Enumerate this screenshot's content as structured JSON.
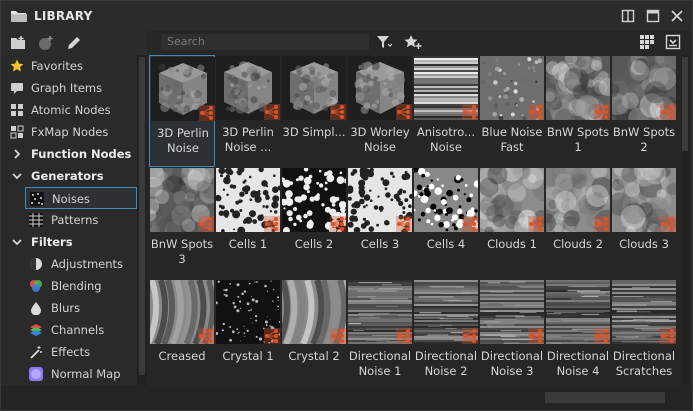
{
  "header": {
    "title": "LIBRARY"
  },
  "search": {
    "placeholder": "Search"
  },
  "sidebar": {
    "items": [
      {
        "label": "Favorites",
        "icon": "star-icon",
        "level": 0
      },
      {
        "label": "Graph Items",
        "icon": "graph-items-icon",
        "level": 0
      },
      {
        "label": "Atomic Nodes",
        "icon": "atomic-nodes-icon",
        "level": 0
      },
      {
        "label": "FxMap Nodes",
        "icon": "fxmap-icon",
        "level": 0
      },
      {
        "label": "Function Nodes",
        "icon": "chevron-right-icon",
        "level": 0,
        "bold": true
      },
      {
        "label": "Generators",
        "icon": "chevron-down-icon",
        "level": 0,
        "bold": true
      },
      {
        "label": "Noises",
        "icon": "noises-icon",
        "level": 1,
        "selected": true
      },
      {
        "label": "Patterns",
        "icon": "patterns-icon",
        "level": 1
      },
      {
        "label": "Filters",
        "icon": "chevron-down-icon",
        "level": 0,
        "bold": true
      },
      {
        "label": "Adjustments",
        "icon": "adjustments-icon",
        "level": 1
      },
      {
        "label": "Blending",
        "icon": "blending-icon",
        "level": 1
      },
      {
        "label": "Blurs",
        "icon": "blurs-icon",
        "level": 1
      },
      {
        "label": "Channels",
        "icon": "channels-icon",
        "level": 1
      },
      {
        "label": "Effects",
        "icon": "effects-icon",
        "level": 1
      },
      {
        "label": "Normal Map",
        "icon": "normal-map-icon",
        "level": 1
      }
    ]
  },
  "grid": {
    "items": [
      {
        "label": "3D Perlin Noise",
        "kind": "cube",
        "selected": true
      },
      {
        "label": "3D Perlin Noise ...",
        "kind": "cube"
      },
      {
        "label": "3D Simpl...",
        "kind": "cube"
      },
      {
        "label": "3D Worley Noise",
        "kind": "cube"
      },
      {
        "label": "Anisotro... Noise",
        "kind": "aniso"
      },
      {
        "label": "Blue Noise Fast",
        "kind": "blue"
      },
      {
        "label": "BnW Spots 1",
        "kind": "spots"
      },
      {
        "label": "BnW Spots 2",
        "kind": "spots"
      },
      {
        "label": "BnW Spots 3",
        "kind": "spots"
      },
      {
        "label": "Cells 1",
        "kind": "cells-light"
      },
      {
        "label": "Cells 2",
        "kind": "cells-dark"
      },
      {
        "label": "Cells 3",
        "kind": "cells-light"
      },
      {
        "label": "Cells 4",
        "kind": "cells-bw"
      },
      {
        "label": "Clouds 1",
        "kind": "clouds"
      },
      {
        "label": "Clouds 2",
        "kind": "clouds"
      },
      {
        "label": "Clouds 3",
        "kind": "clouds"
      },
      {
        "label": "Creased",
        "kind": "creased"
      },
      {
        "label": "Crystal 1",
        "kind": "crystal"
      },
      {
        "label": "Crystal 2",
        "kind": "creased"
      },
      {
        "label": "Directional Noise 1",
        "kind": "directional"
      },
      {
        "label": "Directional Noise 2",
        "kind": "directional"
      },
      {
        "label": "Directional Noise 3",
        "kind": "directional"
      },
      {
        "label": "Directional Noise 4",
        "kind": "directional"
      },
      {
        "label": "Directional Scratches",
        "kind": "scratches"
      }
    ]
  },
  "colors": {
    "accent": "#3f8ec0",
    "badge": "#d9542b"
  }
}
